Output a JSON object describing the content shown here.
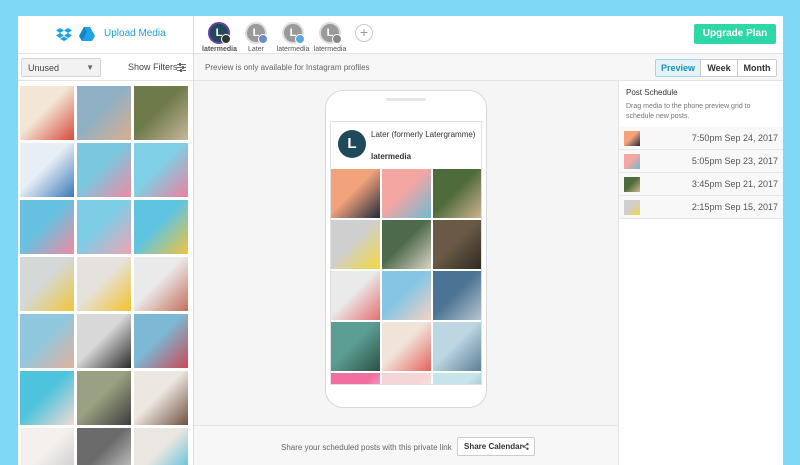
{
  "sidebar": {
    "upload_label": "Upload Media",
    "filter_select": "Unused",
    "show_filters_label": "Show Filters",
    "thumbnails": [
      {
        "colors": [
          "#f3e6d6",
          "#d64a3a"
        ]
      },
      {
        "colors": [
          "#8fb0c4",
          "#d9b08c"
        ]
      },
      {
        "colors": [
          "#6f7a4b",
          "#c6b79b"
        ]
      },
      {
        "colors": [
          "#e7eef4",
          "#3a78b9"
        ]
      },
      {
        "colors": [
          "#7ac7e0",
          "#f08aa0"
        ]
      },
      {
        "colors": [
          "#7fd0e6",
          "#ee7f9c"
        ]
      },
      {
        "colors": [
          "#66c1e0",
          "#f28aa0"
        ]
      },
      {
        "colors": [
          "#7dcde6",
          "#f2a3b3"
        ]
      },
      {
        "colors": [
          "#5ec4e2",
          "#f3c33c"
        ]
      },
      {
        "colors": [
          "#d4d9d8",
          "#f0c53b"
        ]
      },
      {
        "colors": [
          "#e5e2dd",
          "#f3c22b"
        ]
      },
      {
        "colors": [
          "#eaeaea",
          "#c46f5b"
        ]
      },
      {
        "colors": [
          "#8fc7df",
          "#e2b29c"
        ]
      },
      {
        "colors": [
          "#d8d8d8",
          "#2b2b2b"
        ]
      },
      {
        "colors": [
          "#7db8d4",
          "#c94a55"
        ]
      },
      {
        "colors": [
          "#4ec3dd",
          "#f3dbd4"
        ]
      },
      {
        "colors": [
          "#9aa182",
          "#3d3d3d"
        ]
      },
      {
        "colors": [
          "#ede7e1",
          "#6f5040"
        ]
      },
      {
        "colors": [
          "#f3f0ee",
          "#c7c7c7"
        ]
      },
      {
        "colors": [
          "#6b6b6b",
          "#d8d8d8"
        ]
      },
      {
        "colors": [
          "#eae6e1",
          "#3fb8d8"
        ]
      }
    ]
  },
  "profiles": [
    {
      "name": "latermedia",
      "letter": "L",
      "badge": "instagram",
      "active": true
    },
    {
      "name": "Later",
      "letter": "L",
      "badge": "facebook",
      "active": false
    },
    {
      "name": "latermedia",
      "letter": "L",
      "badge": "twitter",
      "active": false
    },
    {
      "name": "latermedia",
      "letter": "L",
      "badge": "pinterest",
      "active": false
    }
  ],
  "add_profile_symbol": "+",
  "upgrade_label": "Upgrade Plan",
  "preview_note": "Preview is only available for Instagram profiles",
  "view_tabs": {
    "preview": "Preview",
    "week": "Week",
    "month": "Month",
    "active": "Preview"
  },
  "phone": {
    "account_title": "Later (formerly Latergramme)",
    "account_handle": "latermedia",
    "avatar_letter": "L",
    "grid": [
      {
        "colors": [
          "#f2a37b",
          "#1f2b3a"
        ]
      },
      {
        "colors": [
          "#f4a6a3",
          "#6fb9d2"
        ]
      },
      {
        "colors": [
          "#4e6b3b",
          "#cfb38e"
        ]
      },
      {
        "colors": [
          "#cfcfcf",
          "#f4d93c"
        ]
      },
      {
        "colors": [
          "#4d6b4c",
          "#d9d2c6"
        ]
      },
      {
        "colors": [
          "#6a5a45",
          "#2e2a24"
        ]
      },
      {
        "colors": [
          "#eaeaea",
          "#e46f6f"
        ]
      },
      {
        "colors": [
          "#86c5e4",
          "#f2d3c2"
        ]
      },
      {
        "colors": [
          "#4b7393",
          "#b8c7cf"
        ]
      },
      {
        "colors": [
          "#5b9e93",
          "#2e5045"
        ]
      },
      {
        "colors": [
          "#f1e3d7",
          "#e5625e"
        ]
      },
      {
        "colors": [
          "#bcd6e2",
          "#5b7d92"
        ]
      },
      {
        "colors": [
          "#f06ea0",
          "#f9f3f3"
        ]
      },
      {
        "colors": [
          "#f5d5d6",
          "#ffffff"
        ]
      },
      {
        "colors": [
          "#c7e3ec",
          "#5b8da6"
        ]
      }
    ]
  },
  "share": {
    "text": "Share your scheduled posts with this private link",
    "button": "Share Calendar"
  },
  "schedule": {
    "title": "Post Schedule",
    "subtitle": "Drag media to the phone preview grid to schedule new posts.",
    "items": [
      {
        "time": "7:50pm Sep 24, 2017",
        "colors": [
          "#f2a37b",
          "#1f2b3a"
        ]
      },
      {
        "time": "5:05pm Sep 23, 2017",
        "colors": [
          "#f4a6a3",
          "#6fb9d2"
        ]
      },
      {
        "time": "3:45pm Sep 21, 2017",
        "colors": [
          "#4e6b3b",
          "#cfb38e"
        ]
      },
      {
        "time": "2:15pm Sep 15, 2017",
        "colors": [
          "#cfcfcf",
          "#f4d93c"
        ]
      }
    ]
  },
  "colors": {
    "accent_green": "#2ed8a6",
    "accent_blue": "#1aa3e8",
    "page_bg": "#7fd8f5",
    "active_tab": "#e3f3f9"
  }
}
